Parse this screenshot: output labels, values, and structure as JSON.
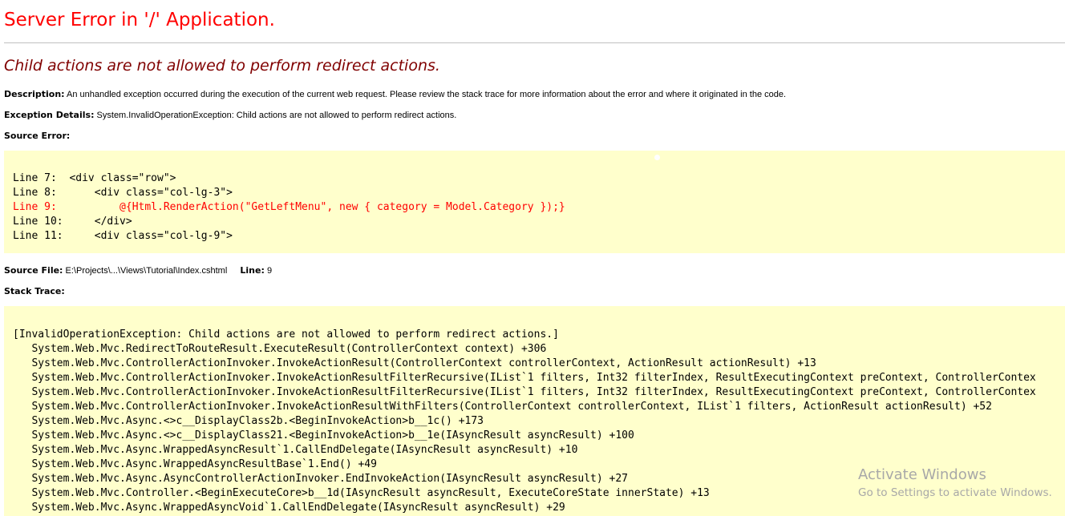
{
  "error_page": {
    "title": "Server Error in '/' Application.",
    "message": "Child actions are not allowed to perform redirect actions.",
    "description_label": "Description:",
    "description_text": "An unhandled exception occurred during the execution of the current web request. Please review the stack trace for more information about the error and where it originated in the code.",
    "exception_label": "Exception Details:",
    "exception_text": "System.InvalidOperationException: Child actions are not allowed to perform redirect actions.",
    "source_error_label": "Source Error:",
    "source_lines": [
      {
        "text": "Line 7:  <div class=\"row\">",
        "highlight": false
      },
      {
        "text": "Line 8:      <div class=\"col-lg-3\">",
        "highlight": false
      },
      {
        "text": "Line 9:          @{Html.RenderAction(\"GetLeftMenu\", new { category = Model.Category });}",
        "highlight": true
      },
      {
        "text": "Line 10:     </div>",
        "highlight": false
      },
      {
        "text": "Line 11:     <div class=\"col-lg-9\">",
        "highlight": false
      }
    ],
    "source_file_label": "Source File:",
    "source_file_path": "E:\\Projects\\...\\Views\\Tutorial\\Index.cshtml",
    "line_label": "Line:",
    "line_number": "9",
    "stack_trace_label": "Stack Trace:",
    "stack_trace": [
      "[InvalidOperationException: Child actions are not allowed to perform redirect actions.]",
      "   System.Web.Mvc.RedirectToRouteResult.ExecuteResult(ControllerContext context) +306",
      "   System.Web.Mvc.ControllerActionInvoker.InvokeActionResult(ControllerContext controllerContext, ActionResult actionResult) +13",
      "   System.Web.Mvc.ControllerActionInvoker.InvokeActionResultFilterRecursive(IList`1 filters, Int32 filterIndex, ResultExecutingContext preContext, ControllerContex",
      "   System.Web.Mvc.ControllerActionInvoker.InvokeActionResultFilterRecursive(IList`1 filters, Int32 filterIndex, ResultExecutingContext preContext, ControllerContex",
      "   System.Web.Mvc.ControllerActionInvoker.InvokeActionResultWithFilters(ControllerContext controllerContext, IList`1 filters, ActionResult actionResult) +52",
      "   System.Web.Mvc.Async.<>c__DisplayClass2b.<BeginInvokeAction>b__1c() +173",
      "   System.Web.Mvc.Async.<>c__DisplayClass21.<BeginInvokeAction>b__1e(IAsyncResult asyncResult) +100",
      "   System.Web.Mvc.Async.WrappedAsyncResult`1.CallEndDelegate(IAsyncResult asyncResult) +10",
      "   System.Web.Mvc.Async.WrappedAsyncResultBase`1.End() +49",
      "   System.Web.Mvc.Async.AsyncControllerActionInvoker.EndInvokeAction(IAsyncResult asyncResult) +27",
      "   System.Web.Mvc.Controller.<BeginExecuteCore>b__1d(IAsyncResult asyncResult, ExecuteCoreState innerState) +13",
      "   System.Web.Mvc.Async.WrappedAsyncVoid`1.CallEndDelegate(IAsyncResult asyncResult) +29"
    ]
  },
  "watermark": {
    "title": "Activate Windows",
    "subtitle": "Go to Settings to activate Windows."
  },
  "colors": {
    "title": "#ff0000",
    "subtitle": "#800000",
    "code_background": "#ffffcc",
    "highlight": "#ff0000"
  }
}
